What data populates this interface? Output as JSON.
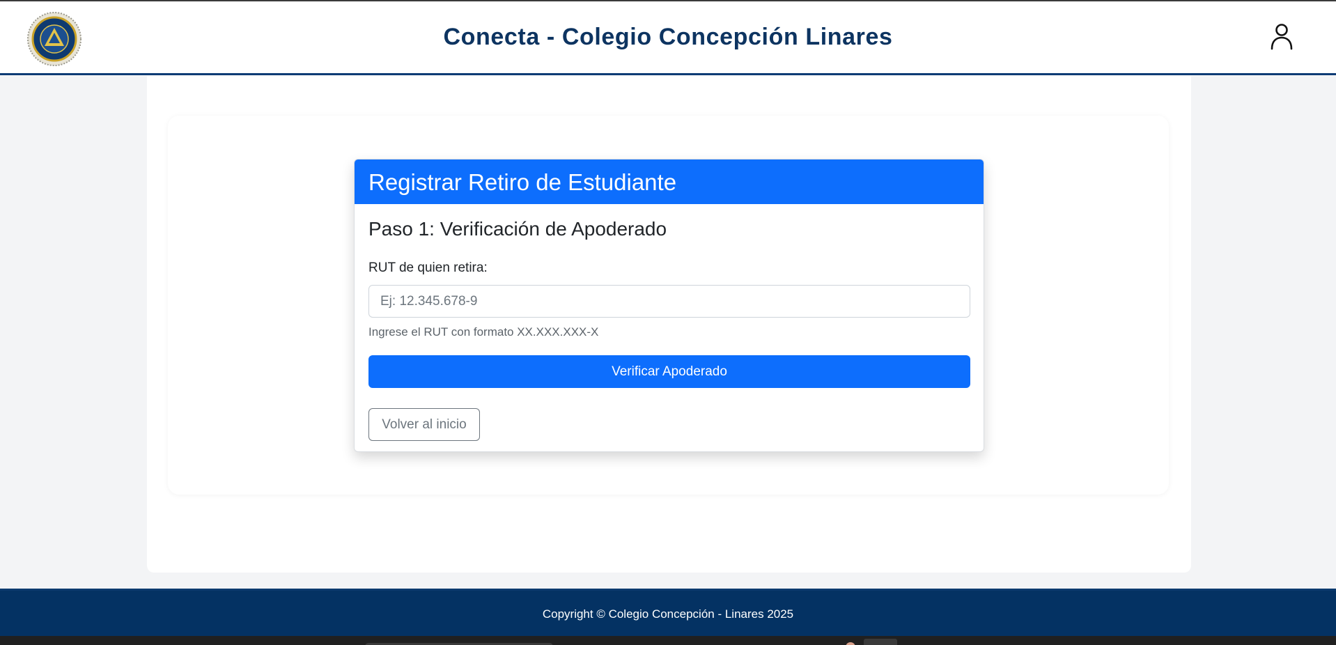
{
  "header": {
    "title": "Conecta - Colegio Concepción Linares",
    "logo_icon": "school-crest-logo",
    "user_icon": "user-icon"
  },
  "card": {
    "title": "Registrar Retiro de Estudiante",
    "step_title": "Paso 1: Verificación de Apoderado",
    "rut_label": "RUT de quien retira:",
    "rut_value": "",
    "rut_placeholder": "Ej: 12.345.678-9",
    "rut_help": "Ingrese el RUT con formato XX.XXX.XXX-X",
    "verify_button": "Verificar Apoderado",
    "back_button": "Volver al inicio"
  },
  "footer": {
    "copyright": "Copyright © Colegio Concepción - Linares 2025"
  },
  "colors": {
    "primary": "#0d6efd",
    "navy": "#043263",
    "title_navy": "#0d3461"
  }
}
